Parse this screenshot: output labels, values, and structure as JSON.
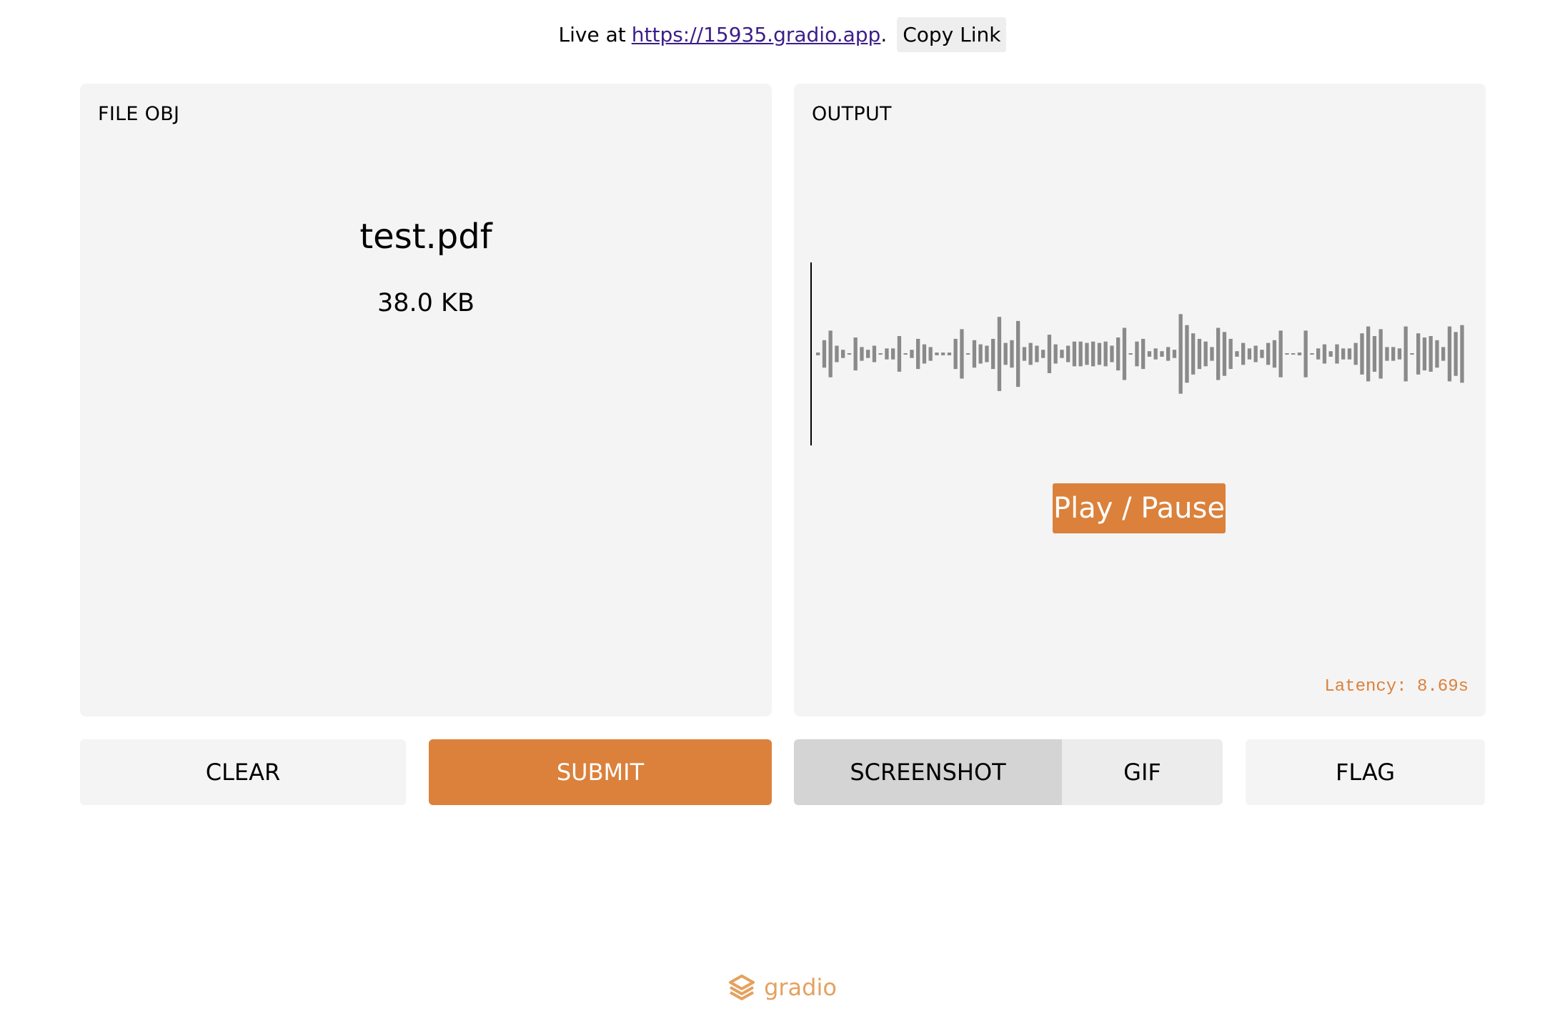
{
  "header": {
    "live_prefix": "Live at",
    "link_text": "https://15935.gradio.app",
    "link_suffix": ".",
    "copy_label": "Copy Link"
  },
  "input_panel": {
    "label": "FILE OBJ",
    "file_name": "test.pdf",
    "file_size": "38.0 KB"
  },
  "output_panel": {
    "label": "OUTPUT",
    "play_label": "Play / Pause",
    "latency": "Latency: 8.69s"
  },
  "buttons": {
    "clear": "CLEAR",
    "submit": "SUBMIT",
    "screenshot": "SCREENSHOT",
    "gif": "GIF",
    "flag": "FLAG"
  },
  "footer": {
    "brand": "gradio",
    "logo_icon": "gradio-logo-icon"
  },
  "colors": {
    "accent": "#db813b",
    "panel": "#f4f4f4",
    "waveform": "#8a8a8a",
    "link": "#3b1e8a"
  },
  "waveform": {
    "amplitudes": [
      0.02,
      0.2,
      0.34,
      0.12,
      0.06,
      0.0,
      0.24,
      0.1,
      0.06,
      0.12,
      0.0,
      0.08,
      0.08,
      0.26,
      0.0,
      0.06,
      0.22,
      0.14,
      0.1,
      0.02,
      0.02,
      0.02,
      0.22,
      0.36,
      0.0,
      0.2,
      0.14,
      0.12,
      0.22,
      0.54,
      0.16,
      0.2,
      0.48,
      0.1,
      0.16,
      0.12,
      0.06,
      0.28,
      0.14,
      0.06,
      0.12,
      0.18,
      0.18,
      0.16,
      0.18,
      0.16,
      0.18,
      0.12,
      0.24,
      0.38,
      0.0,
      0.18,
      0.22,
      0.04,
      0.08,
      0.04,
      0.1,
      0.06,
      0.58,
      0.42,
      0.3,
      0.22,
      0.18,
      0.1,
      0.38,
      0.32,
      0.22,
      0.04,
      0.16,
      0.08,
      0.12,
      0.06,
      0.16,
      0.2,
      0.34,
      0.0,
      0.0,
      0.02,
      0.34,
      0.0,
      0.08,
      0.14,
      0.04,
      0.14,
      0.08,
      0.08,
      0.16,
      0.3,
      0.4,
      0.26,
      0.36,
      0.1,
      0.1,
      0.08,
      0.4,
      0.0,
      0.3,
      0.24,
      0.26,
      0.2,
      0.1,
      0.4,
      0.32,
      0.42
    ]
  }
}
